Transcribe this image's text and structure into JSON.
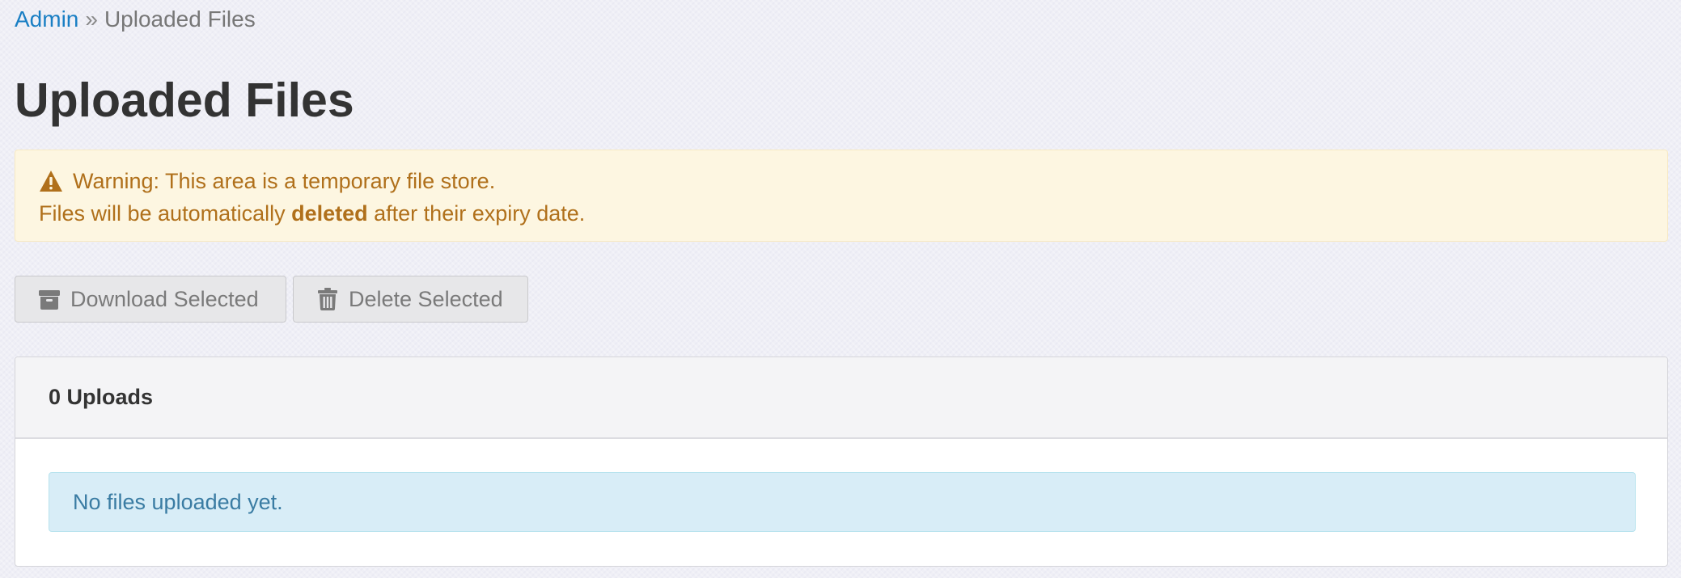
{
  "breadcrumb": {
    "root": "Admin",
    "separator": "»",
    "current": "Uploaded Files"
  },
  "page": {
    "title": "Uploaded Files"
  },
  "warning": {
    "line1": "Warning: This area is a temporary file store.",
    "line2_before": "Files will be automatically ",
    "line2_bold": "deleted",
    "line2_after": " after their expiry date.",
    "icon": "warning-triangle-icon",
    "color": "#b0701b"
  },
  "toolbar": {
    "download_label": "Download Selected",
    "download_icon": "archive-icon",
    "delete_label": "Delete Selected",
    "delete_icon": "trash-icon"
  },
  "uploads_panel": {
    "heading": "0 Uploads",
    "empty_message": "No files uploaded yet."
  },
  "colors": {
    "link": "#1a7fc4",
    "info_bg": "#d8edf7",
    "info_text": "#3a7ca3",
    "warning_bg": "#fdf6e1"
  }
}
